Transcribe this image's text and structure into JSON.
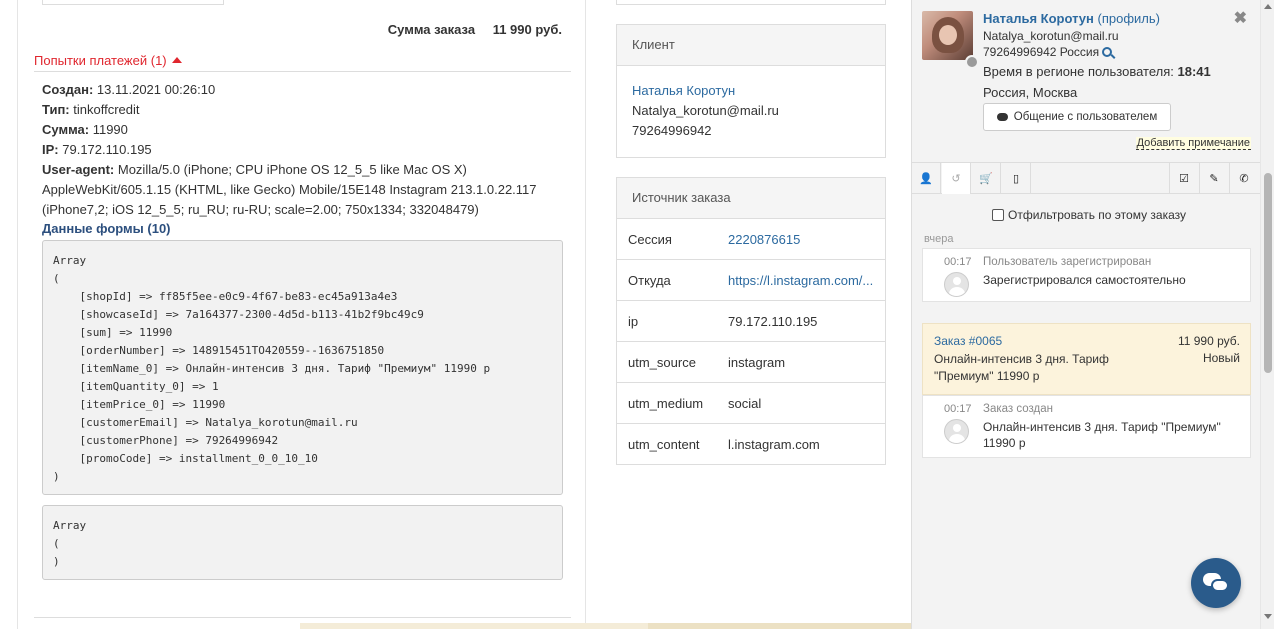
{
  "order": {
    "total_label": "Сумма заказа",
    "total_value": "11 990 руб."
  },
  "payment_attempts": {
    "header": "Попытки платежей (1)",
    "created_label": "Создан:",
    "created_value": "13.11.2021 00:26:10",
    "type_label": "Тип:",
    "type_value": "tinkoffcredit",
    "sum_label": "Сумма:",
    "sum_value": "11990",
    "ip_label": "IP:",
    "ip_value": "79.172.110.195",
    "ua_label": "User-agent:",
    "ua_value": "Mozilla/5.0 (iPhone; CPU iPhone OS 12_5_5 like Mac OS X) AppleWebKit/605.1.15 (KHTML, like Gecko) Mobile/15E148 Instagram 213.1.0.22.117 (iPhone7,2; iOS 12_5_5; ru_RU; ru-RU; scale=2.00; 750x1334; 332048479)",
    "form_data_link": "Данные формы (10)",
    "form_dump": "Array\n(\n    [shopId] => ff85f5ee-e0c9-4f67-be83-ec45a913a4e3\n    [showcaseId] => 7a164377-2300-4d5d-b113-41b2f9bc49c9\n    [sum] => 11990\n    [orderNumber] => 148915451TO420559--1636751850\n    [itemName_0] => Онлайн-интенсив 3 дня. Тариф \"Премиум\" 11990 р\n    [itemQuantity_0] => 1\n    [itemPrice_0] => 11990\n    [customerEmail] => Natalya_korotun@mail.ru\n    [customerPhone] => 79264996942\n    [promoCode] => installment_0_0_10_10\n)",
    "empty_dump": "Array\n(\n)"
  },
  "client_panel": {
    "title": "Клиент",
    "name": "Наталья Коротун",
    "email": "Natalya_korotun@mail.ru",
    "phone": "79264996942"
  },
  "source_panel": {
    "title": "Источник заказа",
    "rows": [
      {
        "key": "Сессия",
        "value": "2220876615"
      },
      {
        "key": "Откуда",
        "value": "https://l.instagram.com/..."
      },
      {
        "key": "ip",
        "value": "79.172.110.195"
      },
      {
        "key": "utm_source",
        "value": "instagram"
      },
      {
        "key": "utm_medium",
        "value": "social"
      },
      {
        "key": "utm_content",
        "value": "l.instagram.com"
      }
    ]
  },
  "sidebar": {
    "user_name": "Наталья Коротун",
    "profile_link": "(профиль)",
    "email": "Natalya_korotun@mail.ru",
    "phone": "79264996942",
    "country": "Россия",
    "region_time_label": "Время в регионе пользователя:",
    "region_time": "18:41",
    "city": "Россия, Москва",
    "chat_button": "Общение с пользователем",
    "add_note": "Добавить примечание",
    "close": "✖",
    "tabs": {
      "profile": "👤",
      "history": "↺",
      "cart": "🛒",
      "device": "▯",
      "tasks": "☑",
      "edit": "✎",
      "call": "✆"
    },
    "filter_label": "Отфильтровать по этому заказу",
    "yesterday": "вчера",
    "event_1": {
      "time": "00:17",
      "title": "Пользователь зарегистрирован",
      "text": "Зарегистрировался самостоятельно"
    },
    "order_card": {
      "link": "Заказ #0065",
      "sum": "11 990 руб.",
      "desc": "Онлайн-интенсив 3 дня. Тариф \"Премиум\" 11990 р",
      "status": "Новый"
    },
    "event_2": {
      "time": "00:17",
      "title": "Заказ создан",
      "text": "Онлайн-интенсив 3 дня. Тариф \"Премиум\" 11990 р"
    }
  },
  "colors": {
    "link": "#2c6aa0",
    "attempts_red": "#e0262e",
    "order_card_bg": "#fcf3dc",
    "chat_fab": "#2a5b8b"
  }
}
